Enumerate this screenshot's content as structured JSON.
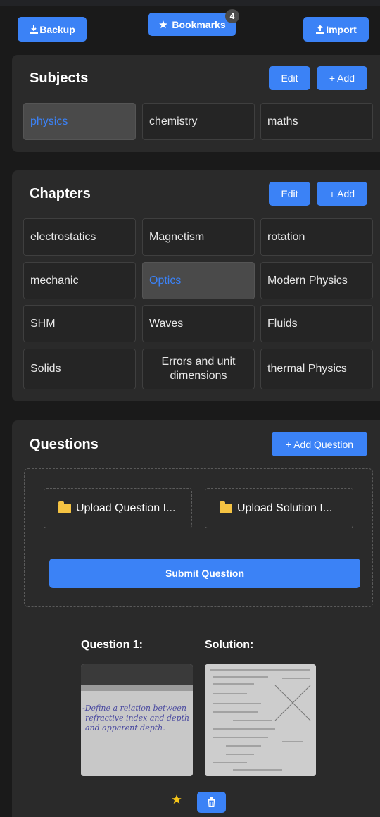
{
  "toolbar": {
    "backup_label": "Backup",
    "bookmarks_label": "Bookmarks",
    "bookmarks_count": "4",
    "import_label": "Import"
  },
  "subjects": {
    "title": "Subjects",
    "edit_label": "Edit",
    "add_label": "+ Add",
    "items": [
      "physics",
      "chemistry",
      "maths"
    ],
    "selected": "physics"
  },
  "chapters": {
    "title": "Chapters",
    "edit_label": "Edit",
    "add_label": "+ Add",
    "items": [
      "electrostatics",
      "Magnetism",
      "rotation",
      "mechanic",
      "Optics",
      "Modern Physics",
      "SHM",
      "Waves",
      "Fluids",
      "Solids",
      "Errors and unit dimensions",
      "thermal Physics"
    ],
    "selected": "Optics"
  },
  "questions": {
    "title": "Questions",
    "add_label": "+ Add Question",
    "upload_question_label": "Upload Question I...",
    "upload_solution_label": "Upload Solution I...",
    "submit_label": "Submit Question",
    "entries": [
      {
        "question_label": "Question 1:",
        "solution_label": "Solution:",
        "question_text": "Define a relation between refractive index and apparent depth."
      }
    ]
  },
  "colors": {
    "accent": "#3b82f6",
    "background": "#1a1a1a",
    "card": "#2a2a2a",
    "star": "#f5c518"
  }
}
